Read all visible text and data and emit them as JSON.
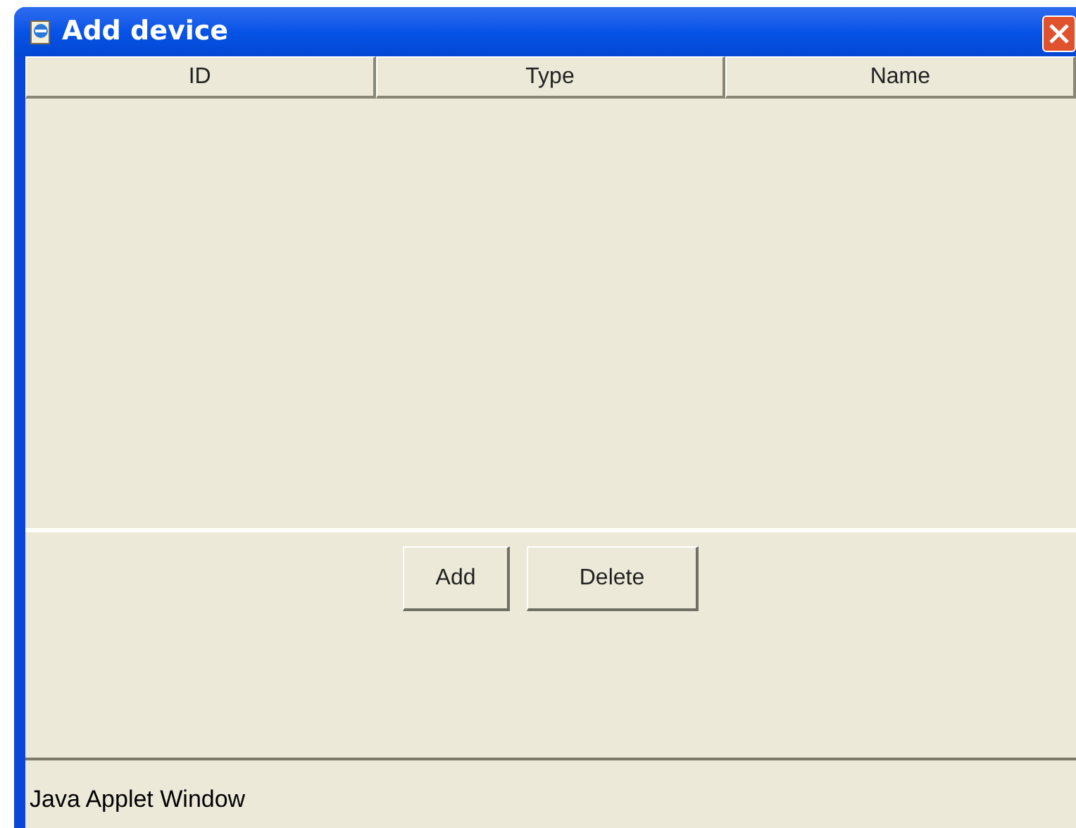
{
  "window": {
    "title": "Add device"
  },
  "table": {
    "columns": [
      "ID",
      "Type",
      "Name"
    ]
  },
  "buttons": [
    "Add",
    "Delete"
  ],
  "status_bar": "Java Applet Window"
}
